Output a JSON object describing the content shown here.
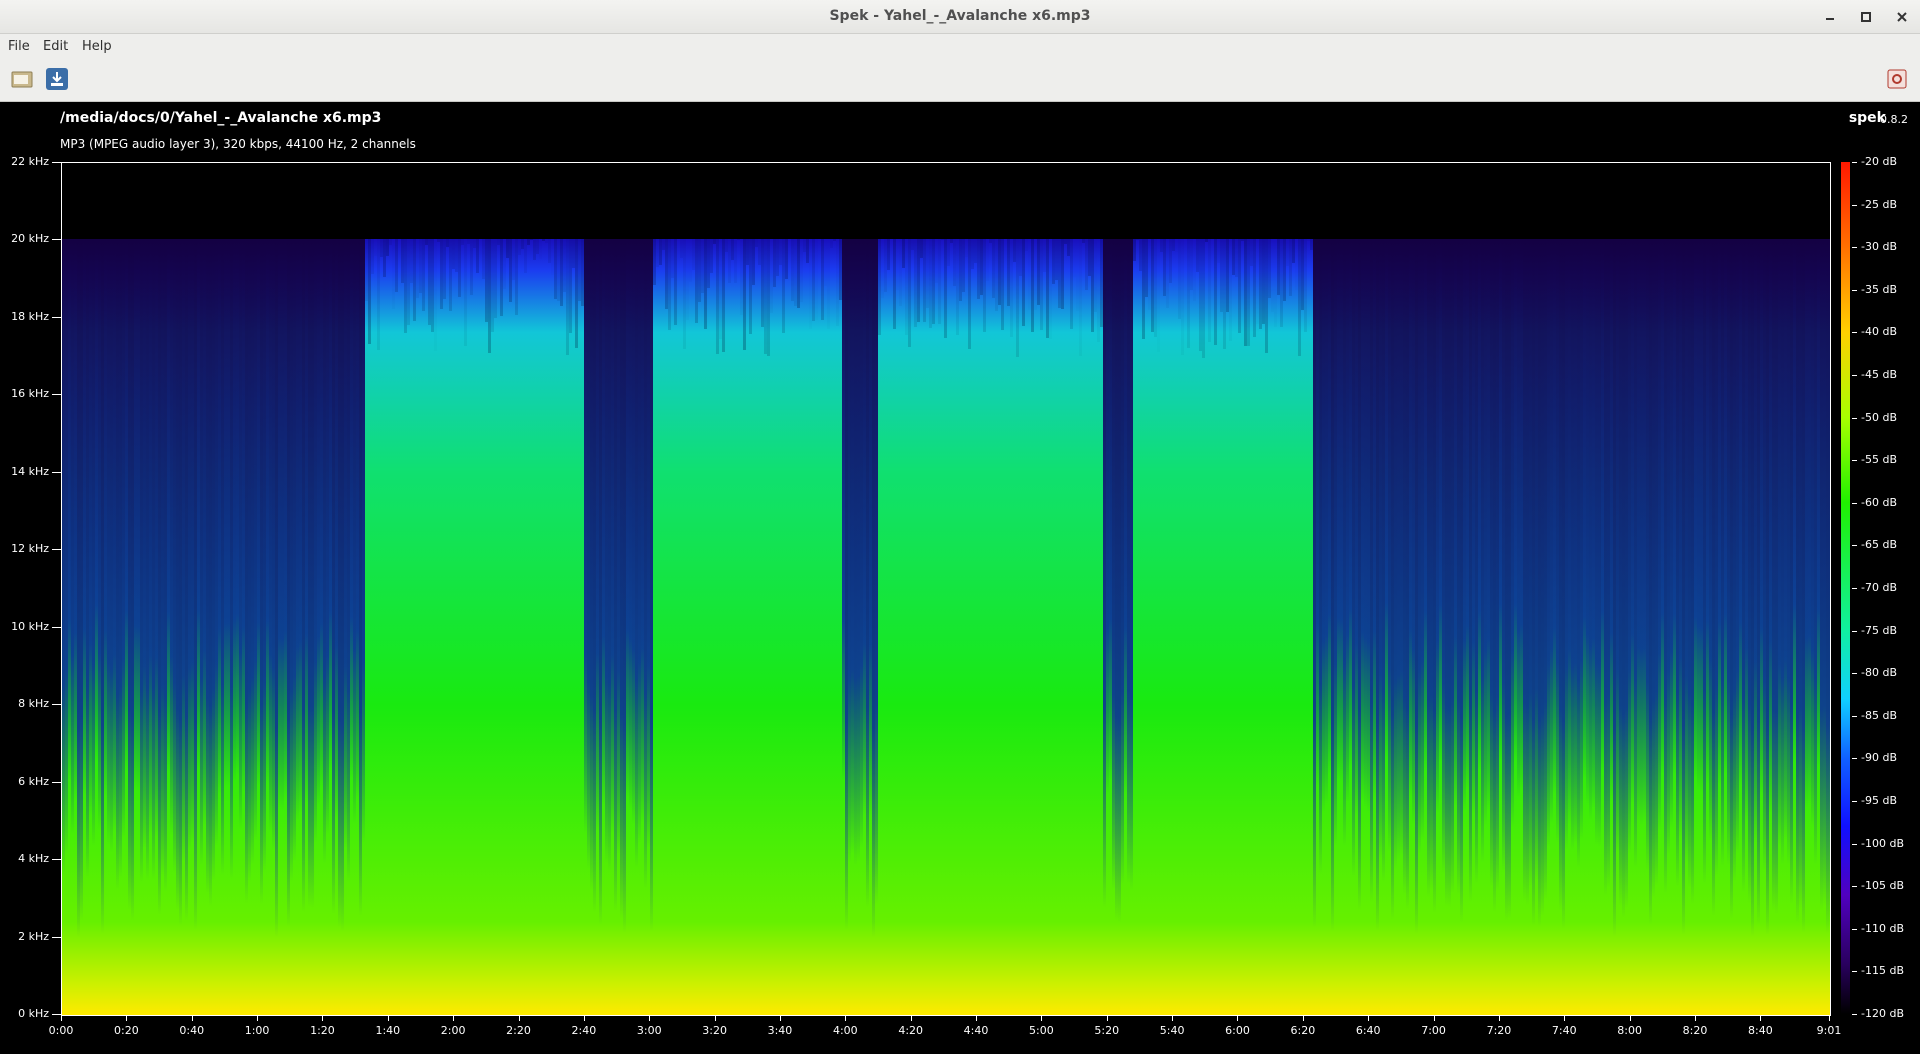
{
  "window": {
    "title": "Spek - Yahel_-_Avalanche x6.mp3",
    "controls": [
      "minimize-icon",
      "maximize-icon",
      "close-icon"
    ]
  },
  "menu": {
    "file": "File",
    "edit": "Edit",
    "help": "Help"
  },
  "toolbar": {
    "open": "folder-open-icon",
    "save": "save-download-icon",
    "about": "preferences-icon"
  },
  "header": {
    "file_path": "/media/docs/0/Yahel_-_Avalanche x6.mp3",
    "file_info": "MP3 (MPEG audio layer 3), 320 kbps, 44100 Hz, 2 channels",
    "app_name": "spek",
    "app_version": "0.8.2"
  },
  "spectrogram": {
    "freq_labels": [
      "22 kHz",
      "20 kHz",
      "18 kHz",
      "16 kHz",
      "14 kHz",
      "12 kHz",
      "10 kHz",
      "8 kHz",
      "6 kHz",
      "4 kHz",
      "2 kHz",
      "0 kHz"
    ],
    "time_labels": [
      "0:00",
      "0:20",
      "0:40",
      "1:00",
      "1:20",
      "1:40",
      "2:00",
      "2:20",
      "2:40",
      "3:00",
      "3:20",
      "3:40",
      "4:00",
      "4:20",
      "4:40",
      "5:00",
      "5:20",
      "5:40",
      "6:00",
      "6:20",
      "6:40",
      "7:00",
      "7:20",
      "7:40",
      "8:00",
      "8:20",
      "8:40",
      "9:01"
    ],
    "db_labels": [
      "-20 dB",
      "-25 dB",
      "-30 dB",
      "-35 dB",
      "-40 dB",
      "-45 dB",
      "-50 dB",
      "-55 dB",
      "-60 dB",
      "-65 dB",
      "-70 dB",
      "-75 dB",
      "-80 dB",
      "-85 dB",
      "-90 dB",
      "-95 dB",
      "-100 dB",
      "-105 dB",
      "-110 dB",
      "-115 dB",
      "-120 dB"
    ],
    "duration_seconds": 541,
    "frequency_max_khz": 22,
    "db_range": [
      -120,
      -20
    ]
  }
}
